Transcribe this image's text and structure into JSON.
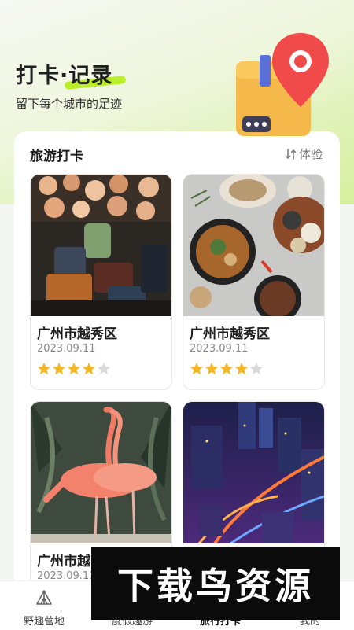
{
  "header": {
    "title": "打卡·记录",
    "subtitle": "留下每个城市的足迹"
  },
  "panel": {
    "title": "旅游打卡",
    "link_label": "体验"
  },
  "cards": [
    {
      "place": "广州市越秀区",
      "date": "2023.09.11",
      "rating": 4,
      "max_rating": 5,
      "photo": "market-lamps-photo"
    },
    {
      "place": "广州市越秀区",
      "date": "2023.09.11",
      "rating": 4,
      "max_rating": 5,
      "photo": "food-platter-photo"
    },
    {
      "place": "广州市越",
      "date": "2023.09.11",
      "rating": null,
      "photo": "flamingo-photo"
    },
    {
      "place": "",
      "date": "",
      "rating": null,
      "photo": "city-night-photo"
    }
  ],
  "tabbar": {
    "items": [
      {
        "label": "野趣营地",
        "icon": "tent-icon"
      },
      {
        "label": "度假趣游",
        "icon": "compass-icon"
      },
      {
        "label": "旅行打卡",
        "icon": "camera-icon"
      },
      {
        "label": "我的",
        "icon": "user-icon"
      }
    ]
  },
  "watermark": {
    "text": "下载鸟资源"
  },
  "colors": {
    "accent": "#b9ef28",
    "star": "#f5b623",
    "star_empty": "#d9d9d9"
  }
}
